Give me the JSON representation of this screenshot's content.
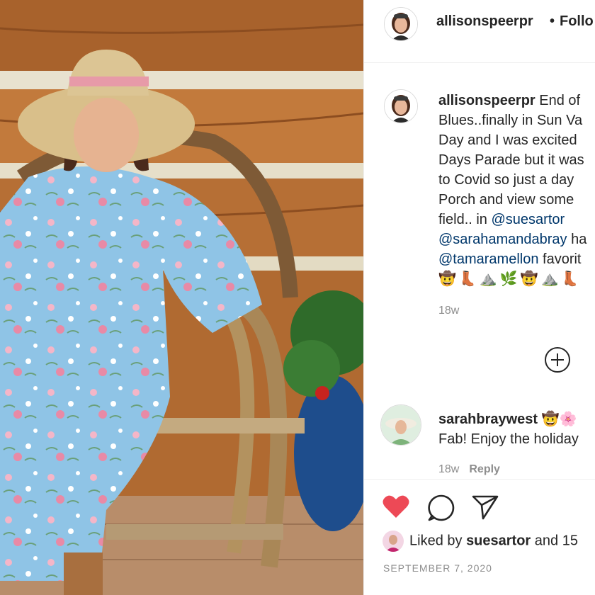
{
  "post": {
    "username": "allisonspeerpr",
    "follow_label": "Follo",
    "separator": "•"
  },
  "caption": {
    "username": "allisonspeerpr",
    "lines": [
      " End of",
      "Blues..finally in Sun Va",
      "Day and I was excited",
      "Days Parade but it was",
      "to Covid so just a day",
      "Porch and view some",
      "field.. in "
    ],
    "mentions": [
      "@suesartor",
      "@sarahamandabray",
      "@tamaramellon"
    ],
    "mention_suffix_1": " ha",
    "mention_suffix_2": " favorit",
    "emojis": "🤠👢⛰️🌿🤠⛰️👢",
    "time": "18w"
  },
  "comment": {
    "username": "sarahbraywest",
    "emojis": "🤠🌸",
    "text": "Fab! Enjoy the holiday",
    "time": "18w",
    "reply_label": "Reply"
  },
  "actions": {
    "liked_by_prefix": "Liked by ",
    "liked_by_user": "suesartor",
    "liked_by_suffix": " and 15",
    "date": "SEPTEMBER 7, 2020"
  },
  "icons": [
    "heart-icon",
    "comment-icon",
    "share-icon",
    "plus-circle-icon"
  ],
  "colors": {
    "like": "#ed4956",
    "mention": "#00376b",
    "muted": "#8e8e8e"
  }
}
